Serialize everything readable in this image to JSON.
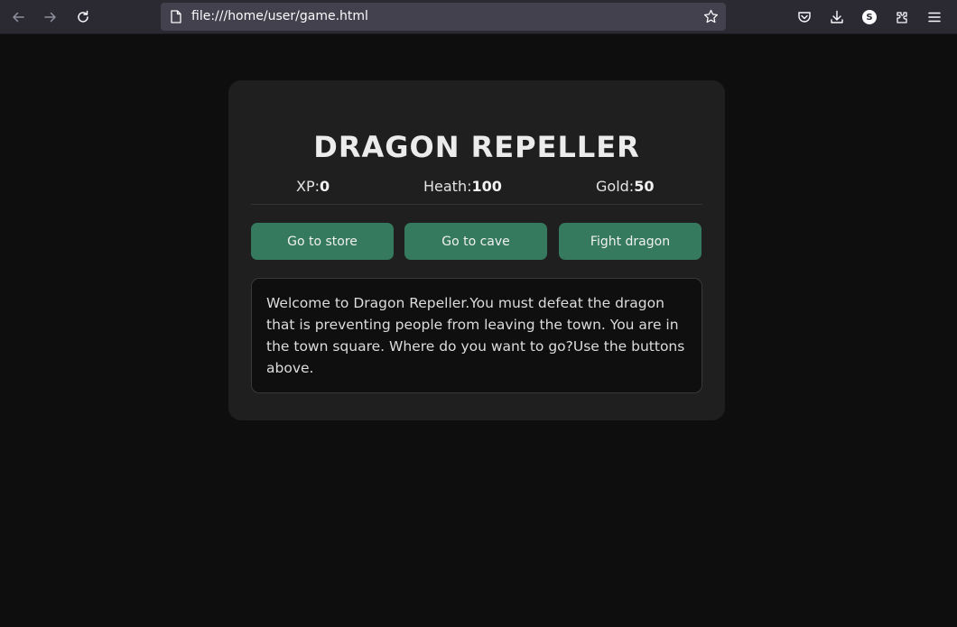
{
  "browser": {
    "url": "file:///home/user/game.html",
    "profile_initial": "S",
    "icons": [
      "back-arrow-icon",
      "forward-arrow-icon",
      "reload-icon",
      "page-icon",
      "bookmark-star-icon",
      "pocket-icon",
      "download-icon",
      "account-icon",
      "extensions-icon",
      "menu-icon"
    ]
  },
  "game": {
    "title": "DRAGON REPELLER",
    "stats": {
      "xp_label": "XP:",
      "xp_value": "0",
      "health_label": "Heath:",
      "health_value": "100",
      "gold_label": "Gold:",
      "gold_value": "50"
    },
    "buttons": {
      "store": "Go to store",
      "cave": "Go to cave",
      "dragon": "Fight dragon"
    },
    "text": "Welcome to Dragon Repeller.You must defeat the dragon that is preventing people from leaving the town. You are in the town square. Where do you want to go?Use the buttons above."
  },
  "colors": {
    "page_bg": "#0e0e0e",
    "card_bg": "#1f1f1f",
    "button_bg": "#357a5e",
    "toolbar_bg": "#2b2a33"
  }
}
